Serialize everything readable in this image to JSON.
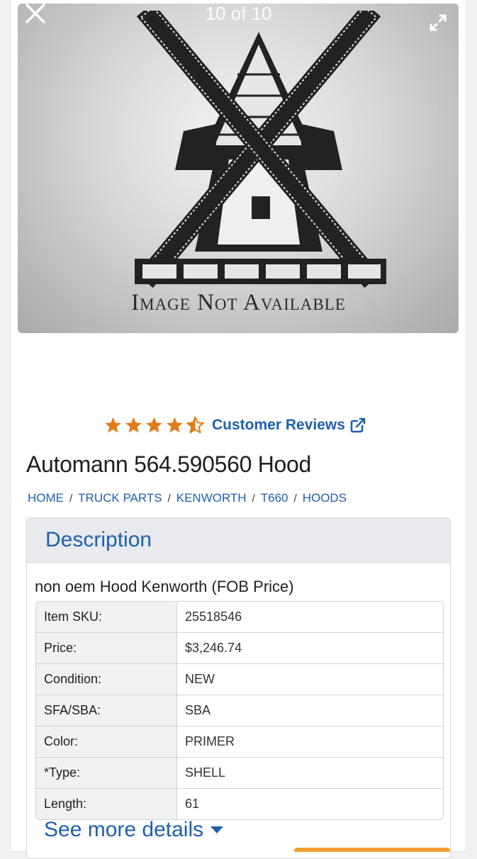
{
  "gallery": {
    "counter": "10 of 10",
    "placeholder_text": "Image Not Available",
    "close_icon": "close-icon",
    "expand_icon": "expand-icon"
  },
  "rating": {
    "value": 4.5,
    "max": 5,
    "star_color": "#e07b1a",
    "reviews_label": "Customer Reviews",
    "reviews_icon": "external-link-icon"
  },
  "product": {
    "title": "Automann 564.590560 Hood"
  },
  "breadcrumb": [
    {
      "label": "HOME"
    },
    {
      "label": "TRUCK PARTS"
    },
    {
      "label": "KENWORTH"
    },
    {
      "label": "T660"
    },
    {
      "label": "HOODS"
    }
  ],
  "description": {
    "heading": "Description",
    "summary": "non oem Hood Kenworth (FOB Price)",
    "specs": [
      {
        "label": "Item SKU:",
        "value": "25518546"
      },
      {
        "label": "Price:",
        "value": "$3,246.74"
      },
      {
        "label": "Condition:",
        "value": "NEW"
      },
      {
        "label": "SFA/SBA:",
        "value": "SBA"
      },
      {
        "label": "Color:",
        "value": "PRIMER"
      },
      {
        "label": "*Type:",
        "value": "SHELL"
      },
      {
        "label": "Length:",
        "value": "61"
      }
    ],
    "see_more_label": "See more details",
    "see_more_icon": "caret-down-icon"
  },
  "colors": {
    "link": "#1f5fae",
    "accent_orange": "#f0a030"
  }
}
